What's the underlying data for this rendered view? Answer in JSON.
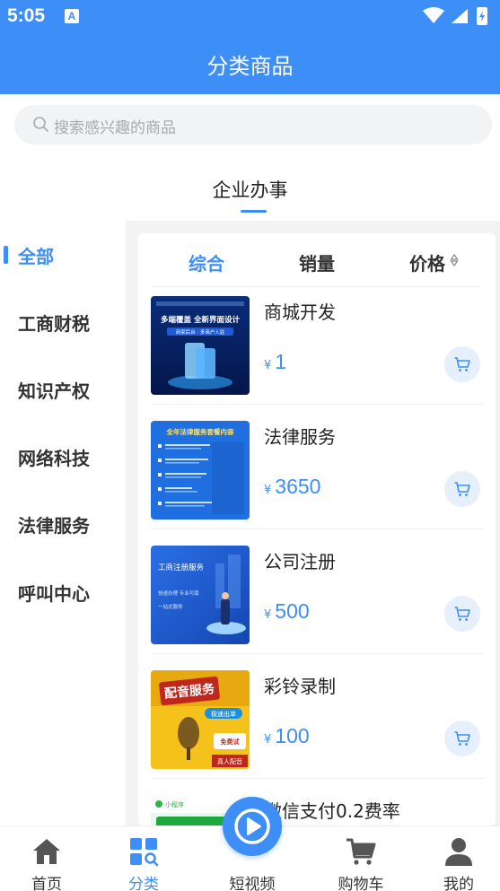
{
  "status_bar": {
    "time": "5:05",
    "notification_letter": "A"
  },
  "header": {
    "title": "分类商品"
  },
  "search": {
    "placeholder": "搜索感兴趣的商品"
  },
  "category": {
    "title": "企业办事"
  },
  "sidebar": {
    "items": [
      {
        "label": "全部",
        "active": true
      },
      {
        "label": "工商财税"
      },
      {
        "label": "知识产权"
      },
      {
        "label": "网络科技"
      },
      {
        "label": "法律服务"
      },
      {
        "label": "呼叫中心"
      }
    ]
  },
  "sort_tabs": [
    {
      "label": "综合",
      "active": true
    },
    {
      "label": "销量"
    },
    {
      "label": "价格"
    }
  ],
  "products": [
    {
      "name": "商城开发",
      "currency": "¥",
      "price": "1",
      "thumb": {
        "line1": "多端覆盖 全新界面设计",
        "line2": "商家后台 · 多商户入驻"
      }
    },
    {
      "name": "法律服务",
      "currency": "¥",
      "price": "3650",
      "thumb": {
        "line1": "全年法律服务套餐内容"
      }
    },
    {
      "name": "公司注册",
      "currency": "¥",
      "price": "500",
      "thumb": {
        "line1": "工商注册服务",
        "line2": "快速办理 专业可靠",
        "line3": "一站式服务"
      }
    },
    {
      "name": "彩铃录制",
      "currency": "¥",
      "price": "100",
      "thumb": {
        "line1": "配音服务",
        "line2": "极速出单",
        "line3": "免费试",
        "line4": "真人配音"
      }
    },
    {
      "name": "微信支付0.2费率",
      "currency": "¥",
      "price": "",
      "thumb": {
        "line1": "小程序"
      }
    }
  ],
  "bottom_nav": [
    {
      "label": "首页",
      "icon": "home-icon"
    },
    {
      "label": "分类",
      "icon": "category-icon",
      "active": true
    },
    {
      "label": "短视频",
      "icon": "play-icon"
    },
    {
      "label": "购物车",
      "icon": "cart-icon"
    },
    {
      "label": "我的",
      "icon": "user-icon"
    }
  ],
  "colors": {
    "accent": "#3e8ef7",
    "background": "#f3f3f3"
  }
}
